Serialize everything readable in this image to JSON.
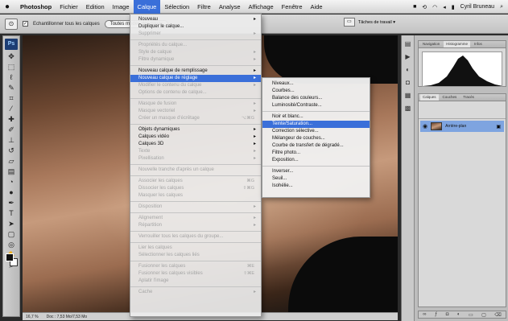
{
  "menubar": {
    "app": "Photoshop",
    "items": [
      "Fichier",
      "Edition",
      "Image",
      "Calque",
      "Sélection",
      "Filtre",
      "Analyse",
      "Affichage",
      "Fenêtre",
      "Aide"
    ],
    "active_index": 3,
    "user": "Cyril Bruneau"
  },
  "optbar": {
    "checkbox_label": "Echantillonner tous les calques",
    "refine_button": "Toutes modes des pixels",
    "workspace": "Tâches de travail ▾"
  },
  "tools": {
    "logo": "Ps",
    "icons": [
      "move-tool",
      "marquee-tool",
      "lasso-tool",
      "quick-select-tool",
      "crop-tool",
      "eyedropper-tool",
      "healing-tool",
      "brush-tool",
      "clone-tool",
      "history-brush-tool",
      "eraser-tool",
      "gradient-tool",
      "blur-tool",
      "dodge-tool",
      "pen-tool",
      "type-tool",
      "path-select-tool",
      "shape-tool",
      "3d-tool",
      "hand-tool",
      "zoom-tool"
    ]
  },
  "calque_menu": {
    "items": [
      {
        "label": "Nouveau",
        "state": "normal",
        "arrow": true
      },
      {
        "label": "Dupliquer le calque...",
        "state": "normal"
      },
      {
        "label": "Supprimer",
        "state": "disabled",
        "arrow": true
      },
      {
        "sep": true
      },
      {
        "label": "Propriétés du calque...",
        "state": "disabled"
      },
      {
        "label": "Style de calque",
        "state": "disabled",
        "arrow": true
      },
      {
        "label": "Filtre dynamique",
        "state": "disabled",
        "arrow": true
      },
      {
        "sep": true
      },
      {
        "label": "Nouveau calque de remplissage",
        "state": "normal",
        "arrow": true
      },
      {
        "label": "Nouveau calque de réglage",
        "state": "highlight",
        "arrow": true
      },
      {
        "label": "Modifier le contenu du calque",
        "state": "disabled",
        "arrow": true
      },
      {
        "label": "Options de contenu de calque...",
        "state": "disabled"
      },
      {
        "sep": true
      },
      {
        "label": "Masque de fusion",
        "state": "disabled",
        "arrow": true
      },
      {
        "label": "Masque vectoriel",
        "state": "disabled",
        "arrow": true
      },
      {
        "label": "Créer un masque d'écrêtage",
        "state": "disabled",
        "shortcut": "⌥⌘G"
      },
      {
        "sep": true
      },
      {
        "label": "Objets dynamiques",
        "state": "normal",
        "arrow": true
      },
      {
        "label": "Calques vidéo",
        "state": "normal",
        "arrow": true
      },
      {
        "label": "Calques 3D",
        "state": "normal",
        "arrow": true
      },
      {
        "label": "Texte",
        "state": "disabled",
        "arrow": true
      },
      {
        "label": "Pixellisation",
        "state": "disabled",
        "arrow": true
      },
      {
        "sep": true
      },
      {
        "label": "Nouvelle tranche d'après un calque",
        "state": "disabled"
      },
      {
        "sep": true
      },
      {
        "label": "Associer les calques",
        "state": "disabled",
        "shortcut": "⌘G"
      },
      {
        "label": "Dissocier les calques",
        "state": "disabled",
        "shortcut": "⇧⌘G"
      },
      {
        "label": "Masquer les calques",
        "state": "disabled"
      },
      {
        "sep": true
      },
      {
        "label": "Disposition",
        "state": "disabled",
        "arrow": true
      },
      {
        "sep": true
      },
      {
        "label": "Alignement",
        "state": "disabled",
        "arrow": true
      },
      {
        "label": "Répartition",
        "state": "disabled",
        "arrow": true
      },
      {
        "sep": true
      },
      {
        "label": "Verrouiller tous les calques du groupe...",
        "state": "disabled"
      },
      {
        "sep": true
      },
      {
        "label": "Lier les calques",
        "state": "disabled"
      },
      {
        "label": "Sélectionner les calques liés",
        "state": "disabled"
      },
      {
        "sep": true
      },
      {
        "label": "Fusionner les calques",
        "state": "disabled",
        "shortcut": "⌘E"
      },
      {
        "label": "Fusionner les calques visibles",
        "state": "disabled",
        "shortcut": "⇧⌘E"
      },
      {
        "label": "Aplatir l'image",
        "state": "disabled"
      },
      {
        "sep": true
      },
      {
        "label": "Cache",
        "state": "disabled",
        "arrow": true
      }
    ]
  },
  "reglage_submenu": {
    "items": [
      {
        "label": "Niveaux...",
        "state": "normal"
      },
      {
        "label": "Courbes...",
        "state": "normal"
      },
      {
        "label": "Balance des couleurs...",
        "state": "normal"
      },
      {
        "label": "Luminosité/Contraste...",
        "state": "normal"
      },
      {
        "sep": true
      },
      {
        "label": "Noir et blanc...",
        "state": "normal"
      },
      {
        "label": "Teinte/Saturation...",
        "state": "highlight"
      },
      {
        "label": "Correction sélective...",
        "state": "normal"
      },
      {
        "label": "Mélangeur de couches...",
        "state": "normal"
      },
      {
        "label": "Courbe de transfert de dégradé...",
        "state": "normal"
      },
      {
        "label": "Filtre photo...",
        "state": "normal"
      },
      {
        "label": "Exposition...",
        "state": "normal"
      },
      {
        "sep": true
      },
      {
        "label": "Inverser...",
        "state": "normal"
      },
      {
        "label": "Seuil...",
        "state": "normal"
      },
      {
        "label": "Isohélie...",
        "state": "normal"
      }
    ]
  },
  "panels": {
    "top_tabs": [
      "Navigation",
      "Histogramme",
      "Infos"
    ],
    "layers_tabs": [
      "Calques",
      "Couches",
      "Tracés"
    ],
    "layer_name": "Arrière-plan"
  },
  "status": {
    "zoom": "16,7 %",
    "doc": "Doc : 7,53 Mo/7,53 Mo"
  }
}
